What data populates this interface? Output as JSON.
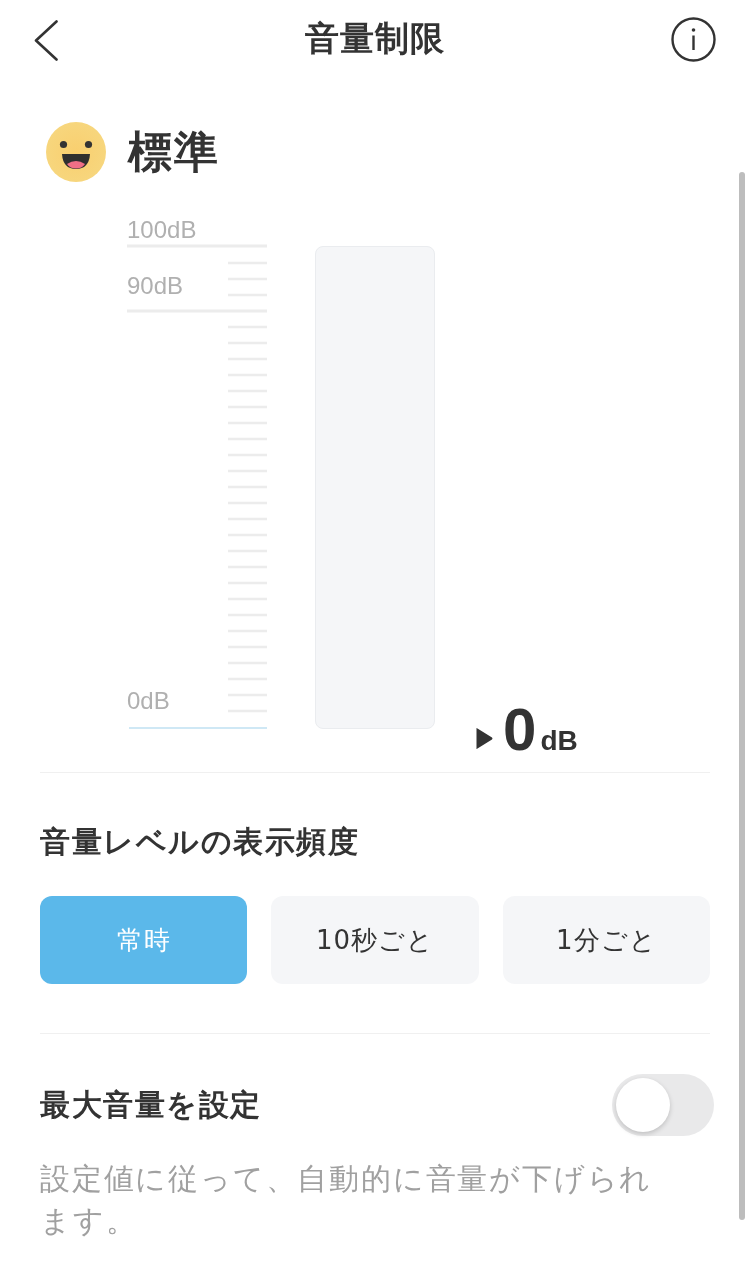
{
  "header": {
    "title": "音量制限"
  },
  "level": {
    "label": "標準"
  },
  "meter": {
    "scale_labels": [
      "100dB",
      "90dB",
      "0dB"
    ],
    "level": 0,
    "reading_value": "0",
    "reading_unit": "dB"
  },
  "display_frequency": {
    "title": "音量レベルの表示頻度",
    "options": [
      {
        "label": "常時",
        "selected": true
      },
      {
        "label": "10秒ごと",
        "selected": false
      },
      {
        "label": "1分ごと",
        "selected": false
      }
    ]
  },
  "max_volume": {
    "label": "最大音量を設定",
    "on": false,
    "description": "設定値に従って、自動的に音量が下げられます。"
  }
}
